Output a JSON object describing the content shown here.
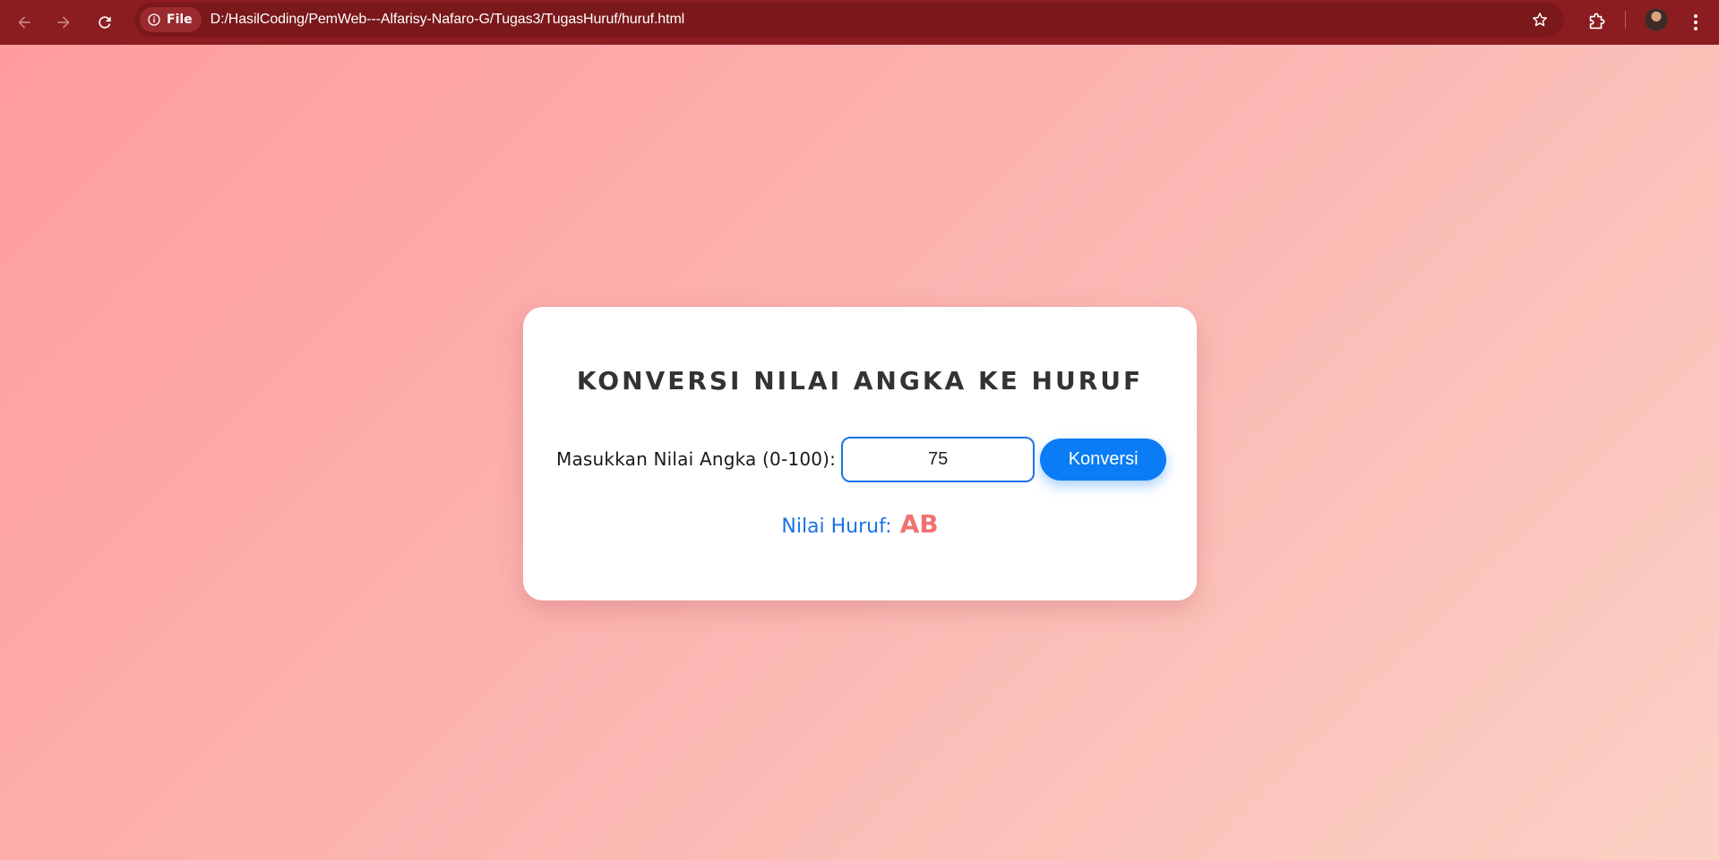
{
  "browser": {
    "site_chip_label": "File",
    "url": "D:/HasilCoding/PemWeb---Alfarisy-Nafaro-G/Tugas3/TugasHuruf/huruf.html",
    "icons": [
      "back-arrow-icon",
      "forward-arrow-icon",
      "reload-icon",
      "info-icon",
      "star-icon",
      "extensions-icon",
      "avatar",
      "more-vert-icon"
    ],
    "toolbar_color": "#8b1c1f"
  },
  "card": {
    "title": "KONVERSI NILAI ANGKA KE HURUF",
    "input_label": "Masukkan Nilai Angka (0-100):",
    "input_value": "75",
    "button_label": "Konversi",
    "result_label": "Nilai Huruf:",
    "result_value": "AB"
  },
  "colors": {
    "accent": "#0a7cf5",
    "result_value": "#f07270",
    "background_start": "#ff9c9e",
    "background_end": "#fbd0c4"
  }
}
